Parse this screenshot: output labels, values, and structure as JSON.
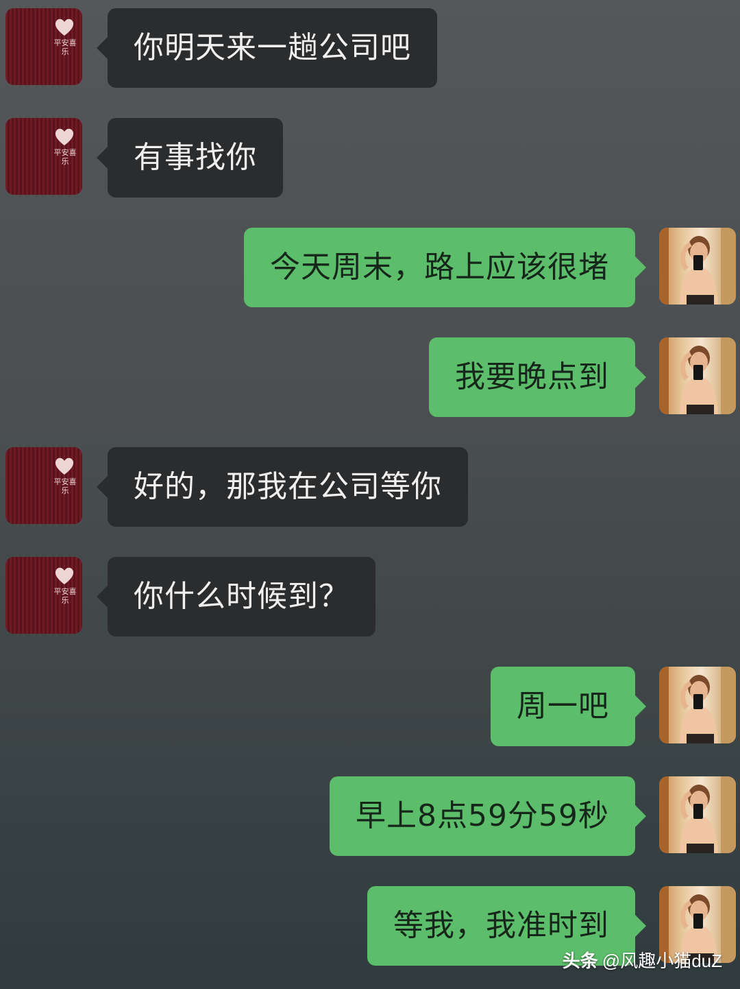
{
  "chat": {
    "messages": [
      {
        "side": "left",
        "text": "你明天来一趟公司吧"
      },
      {
        "side": "left",
        "text": "有事找你"
      },
      {
        "side": "right",
        "text": "今天周末，路上应该很堵"
      },
      {
        "side": "right",
        "text": "我要晚点到"
      },
      {
        "side": "left",
        "text": "好的，那我在公司等你"
      },
      {
        "side": "left",
        "text": "你什么时候到？"
      },
      {
        "side": "right",
        "text": "周一吧"
      },
      {
        "side": "right",
        "text": "早上8点59分59秒"
      },
      {
        "side": "right",
        "text": "等我，我准时到"
      }
    ]
  },
  "sender_avatar": {
    "seal_text": "平安喜乐",
    "icon": "heart-icon"
  },
  "watermark": {
    "brand": "头条",
    "handle": "@风趣小猫duZ"
  },
  "colors": {
    "received_bubble": "#2b2c2d",
    "sent_bubble": "#5cbd6a",
    "received_text": "#f0f0f0",
    "sent_text": "#16261a"
  }
}
